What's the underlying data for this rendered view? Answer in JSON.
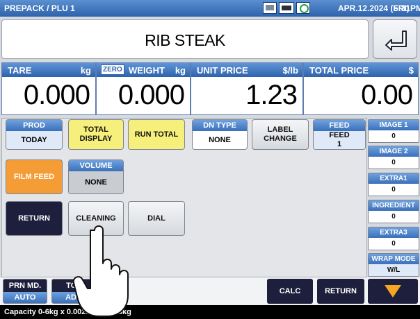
{
  "header": {
    "breadcrumb": "PREPACK / PLU 1",
    "date": "APR.12.2024 (FRI)",
    "time": "5:31PM",
    "status_icons": [
      "monitor-icon",
      "battery-icon",
      "network-icon"
    ]
  },
  "item_name": "RIB STEAK",
  "weights": {
    "tare": {
      "label": "TARE",
      "unit": "kg",
      "value": "0.000"
    },
    "weight": {
      "tag": "ZERO",
      "label": "WEIGHT",
      "unit": "kg",
      "value": "0.000"
    },
    "unit_price": {
      "label": "UNIT PRICE",
      "unit": "$/lb",
      "value": "1.23"
    },
    "total_price": {
      "label": "TOTAL PRICE",
      "unit": "$",
      "value": "0.00"
    }
  },
  "buttons": {
    "prod": {
      "title": "PROD",
      "value": "TODAY"
    },
    "total_display": "TOTAL\nDISPLAY",
    "run_total": "RUN TOTAL",
    "dn_type": {
      "title": "DN TYPE",
      "value": "NONE"
    },
    "label_change": "LABEL\nCHANGE",
    "feed": {
      "title": "FEED",
      "value": "FEED\n1"
    },
    "film_feed": "FILM FEED",
    "volume": {
      "title": "VOLUME",
      "value": "NONE"
    },
    "return": "RETURN",
    "cleaning": "CLEANING",
    "dial": "DIAL"
  },
  "side": [
    {
      "title": "IMAGE 1",
      "value": "0"
    },
    {
      "title": "IMAGE 2",
      "value": "0"
    },
    {
      "title": "EXTRA1",
      "value": "0"
    },
    {
      "title": "INGREDIENT",
      "value": "0"
    },
    {
      "title": "EXTRA3",
      "value": "0"
    },
    {
      "title": "WRAP MODE",
      "value": "W/L"
    }
  ],
  "bottom": {
    "prn_md": {
      "title": "PRN MD.",
      "value": "AUTO"
    },
    "tot": {
      "title": "TOT",
      "value": "ADD"
    },
    "calc": "CALC",
    "return": "RETURN"
  },
  "footer": "Capacity 0-6kg x 0.002kg x 0.005kg",
  "colors": {
    "header": "#2e63ad",
    "accent_orange": "#f49c36",
    "accent_yellow": "#f6ef7b",
    "dark": "#1e1f3c"
  }
}
